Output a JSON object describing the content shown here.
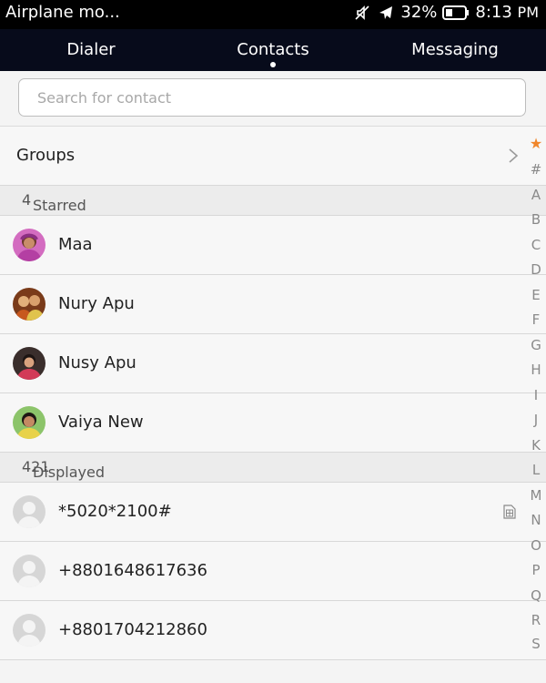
{
  "status_bar": {
    "mode_text": "Airplane mo...",
    "battery": "32%",
    "time": "8:13",
    "ampm": "PM"
  },
  "tabs": [
    {
      "label": "Dialer"
    },
    {
      "label": "Contacts"
    },
    {
      "label": "Messaging"
    }
  ],
  "search": {
    "placeholder": "Search for contact",
    "value": ""
  },
  "groups": {
    "label": "Groups"
  },
  "sections": {
    "starred": {
      "label": "Starred",
      "count": "4"
    },
    "displayed": {
      "label": "Displayed contacts",
      "count": "421"
    }
  },
  "starred_contacts": [
    {
      "name": "Maa"
    },
    {
      "name": "Nury Apu"
    },
    {
      "name": "Nusy Apu"
    },
    {
      "name": "Vaiya New"
    }
  ],
  "contacts": [
    {
      "name": "*5020*2100#"
    },
    {
      "name": "+8801648617636"
    },
    {
      "name": "+8801704212860"
    }
  ],
  "index_letters": [
    "#",
    "A",
    "B",
    "C",
    "D",
    "E",
    "F",
    "G",
    "H",
    "I",
    "J",
    "K",
    "L",
    "M",
    "N",
    "O",
    "P",
    "Q",
    "R",
    "S"
  ],
  "colors": {
    "accent": "#f0862a",
    "tab_bg": "#070b1b"
  }
}
